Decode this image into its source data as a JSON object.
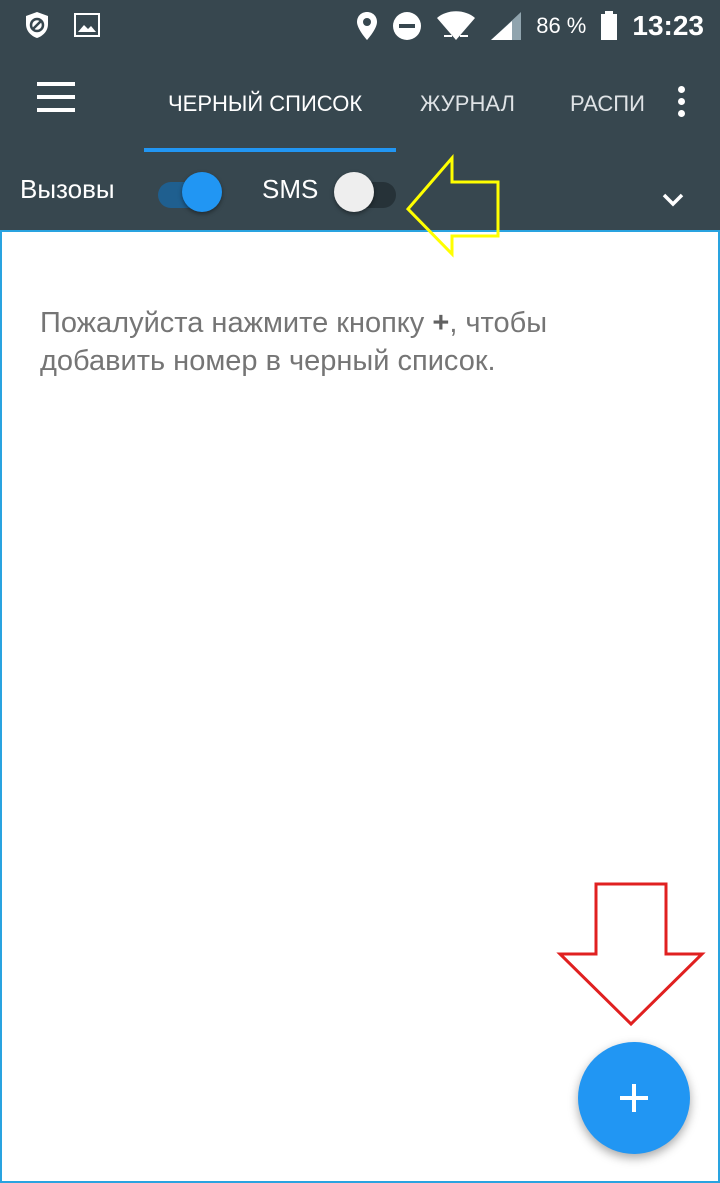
{
  "status_bar": {
    "battery_percent": "86 %",
    "time": "13:23"
  },
  "app_bar": {
    "tabs": [
      {
        "label": "ЧЕРНЫЙ СПИСОК",
        "active": true
      },
      {
        "label": "ЖУРНАЛ",
        "active": false
      },
      {
        "label": "РАСПИ",
        "active": false
      }
    ]
  },
  "filter_bar": {
    "calls_label": "Вызовы",
    "calls_enabled": true,
    "sms_label": "SMS",
    "sms_enabled": false
  },
  "content": {
    "hint_before": "Пожалуйста нажмите кнопку ",
    "hint_symbol": "+",
    "hint_after": ", чтобы добавить номер в черный список."
  },
  "colors": {
    "app_bar": "#37474f",
    "accent": "#2196f3",
    "annotation_yellow": "#ffff00",
    "annotation_red": "#e02020"
  },
  "icons": [
    "block-icon",
    "image-icon",
    "location-icon",
    "dnd-icon",
    "wifi-icon",
    "signal-icon",
    "battery-icon",
    "menu-icon",
    "more-vert-icon",
    "chevron-down-icon",
    "add-icon"
  ]
}
